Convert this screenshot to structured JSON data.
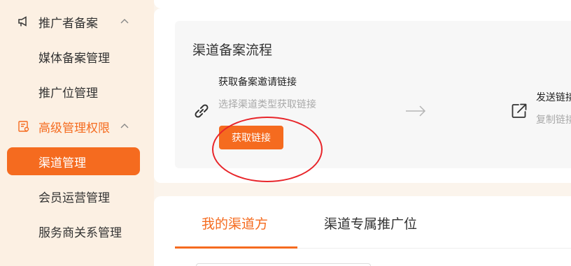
{
  "sidebar": {
    "group_promoter": {
      "label": "推广者备案",
      "icon": "megaphone-icon"
    },
    "items_promoter": [
      {
        "label": "媒体备案管理"
      },
      {
        "label": "推广位管理"
      }
    ],
    "group_advanced": {
      "label": "高级管理权限",
      "icon": "admin-icon"
    },
    "items_advanced": [
      {
        "label": "渠道管理",
        "active": true
      },
      {
        "label": "会员运营管理"
      },
      {
        "label": "服务商关系管理"
      }
    ]
  },
  "flow": {
    "title": "渠道备案流程",
    "step1": {
      "title": "获取备案邀请链接",
      "desc": "选择渠道类型获取链接",
      "button_label": "获取链接",
      "icon": "link-icon"
    },
    "step2": {
      "title": "发送链接",
      "desc": "复制链接",
      "icon": "share-icon"
    }
  },
  "tabs": [
    {
      "label": "我的渠道方",
      "active": true
    },
    {
      "label": "渠道专属推广位",
      "active": false
    }
  ],
  "colors": {
    "accent": "#f56b1f",
    "sidebar_bg": "#fcf0e3",
    "annotation": "#e8252a"
  }
}
